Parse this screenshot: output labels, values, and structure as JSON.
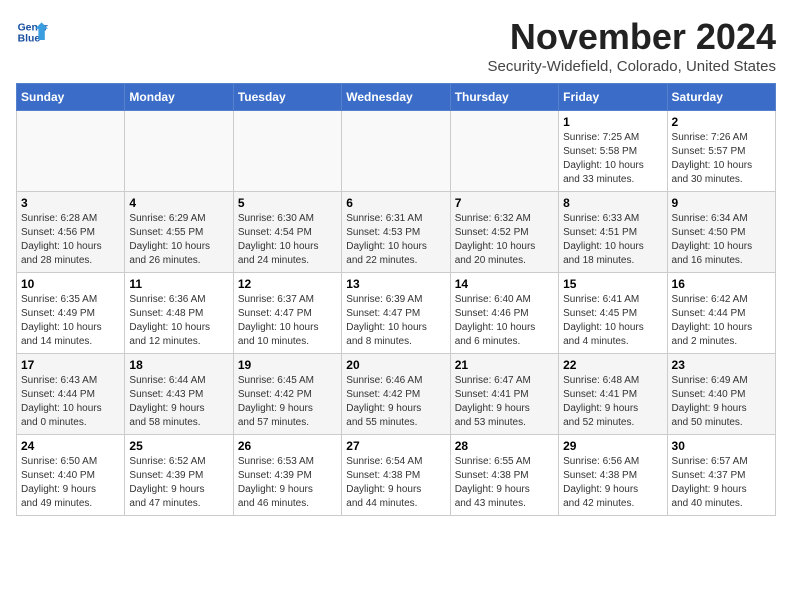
{
  "header": {
    "logo_line1": "General",
    "logo_line2": "Blue",
    "month_year": "November 2024",
    "location": "Security-Widefield, Colorado, United States"
  },
  "weekdays": [
    "Sunday",
    "Monday",
    "Tuesday",
    "Wednesday",
    "Thursday",
    "Friday",
    "Saturday"
  ],
  "weeks": [
    [
      {
        "day": "",
        "info": ""
      },
      {
        "day": "",
        "info": ""
      },
      {
        "day": "",
        "info": ""
      },
      {
        "day": "",
        "info": ""
      },
      {
        "day": "",
        "info": ""
      },
      {
        "day": "1",
        "info": "Sunrise: 7:25 AM\nSunset: 5:58 PM\nDaylight: 10 hours\nand 33 minutes."
      },
      {
        "day": "2",
        "info": "Sunrise: 7:26 AM\nSunset: 5:57 PM\nDaylight: 10 hours\nand 30 minutes."
      }
    ],
    [
      {
        "day": "3",
        "info": "Sunrise: 6:28 AM\nSunset: 4:56 PM\nDaylight: 10 hours\nand 28 minutes."
      },
      {
        "day": "4",
        "info": "Sunrise: 6:29 AM\nSunset: 4:55 PM\nDaylight: 10 hours\nand 26 minutes."
      },
      {
        "day": "5",
        "info": "Sunrise: 6:30 AM\nSunset: 4:54 PM\nDaylight: 10 hours\nand 24 minutes."
      },
      {
        "day": "6",
        "info": "Sunrise: 6:31 AM\nSunset: 4:53 PM\nDaylight: 10 hours\nand 22 minutes."
      },
      {
        "day": "7",
        "info": "Sunrise: 6:32 AM\nSunset: 4:52 PM\nDaylight: 10 hours\nand 20 minutes."
      },
      {
        "day": "8",
        "info": "Sunrise: 6:33 AM\nSunset: 4:51 PM\nDaylight: 10 hours\nand 18 minutes."
      },
      {
        "day": "9",
        "info": "Sunrise: 6:34 AM\nSunset: 4:50 PM\nDaylight: 10 hours\nand 16 minutes."
      }
    ],
    [
      {
        "day": "10",
        "info": "Sunrise: 6:35 AM\nSunset: 4:49 PM\nDaylight: 10 hours\nand 14 minutes."
      },
      {
        "day": "11",
        "info": "Sunrise: 6:36 AM\nSunset: 4:48 PM\nDaylight: 10 hours\nand 12 minutes."
      },
      {
        "day": "12",
        "info": "Sunrise: 6:37 AM\nSunset: 4:47 PM\nDaylight: 10 hours\nand 10 minutes."
      },
      {
        "day": "13",
        "info": "Sunrise: 6:39 AM\nSunset: 4:47 PM\nDaylight: 10 hours\nand 8 minutes."
      },
      {
        "day": "14",
        "info": "Sunrise: 6:40 AM\nSunset: 4:46 PM\nDaylight: 10 hours\nand 6 minutes."
      },
      {
        "day": "15",
        "info": "Sunrise: 6:41 AM\nSunset: 4:45 PM\nDaylight: 10 hours\nand 4 minutes."
      },
      {
        "day": "16",
        "info": "Sunrise: 6:42 AM\nSunset: 4:44 PM\nDaylight: 10 hours\nand 2 minutes."
      }
    ],
    [
      {
        "day": "17",
        "info": "Sunrise: 6:43 AM\nSunset: 4:44 PM\nDaylight: 10 hours\nand 0 minutes."
      },
      {
        "day": "18",
        "info": "Sunrise: 6:44 AM\nSunset: 4:43 PM\nDaylight: 9 hours\nand 58 minutes."
      },
      {
        "day": "19",
        "info": "Sunrise: 6:45 AM\nSunset: 4:42 PM\nDaylight: 9 hours\nand 57 minutes."
      },
      {
        "day": "20",
        "info": "Sunrise: 6:46 AM\nSunset: 4:42 PM\nDaylight: 9 hours\nand 55 minutes."
      },
      {
        "day": "21",
        "info": "Sunrise: 6:47 AM\nSunset: 4:41 PM\nDaylight: 9 hours\nand 53 minutes."
      },
      {
        "day": "22",
        "info": "Sunrise: 6:48 AM\nSunset: 4:41 PM\nDaylight: 9 hours\nand 52 minutes."
      },
      {
        "day": "23",
        "info": "Sunrise: 6:49 AM\nSunset: 4:40 PM\nDaylight: 9 hours\nand 50 minutes."
      }
    ],
    [
      {
        "day": "24",
        "info": "Sunrise: 6:50 AM\nSunset: 4:40 PM\nDaylight: 9 hours\nand 49 minutes."
      },
      {
        "day": "25",
        "info": "Sunrise: 6:52 AM\nSunset: 4:39 PM\nDaylight: 9 hours\nand 47 minutes."
      },
      {
        "day": "26",
        "info": "Sunrise: 6:53 AM\nSunset: 4:39 PM\nDaylight: 9 hours\nand 46 minutes."
      },
      {
        "day": "27",
        "info": "Sunrise: 6:54 AM\nSunset: 4:38 PM\nDaylight: 9 hours\nand 44 minutes."
      },
      {
        "day": "28",
        "info": "Sunrise: 6:55 AM\nSunset: 4:38 PM\nDaylight: 9 hours\nand 43 minutes."
      },
      {
        "day": "29",
        "info": "Sunrise: 6:56 AM\nSunset: 4:38 PM\nDaylight: 9 hours\nand 42 minutes."
      },
      {
        "day": "30",
        "info": "Sunrise: 6:57 AM\nSunset: 4:37 PM\nDaylight: 9 hours\nand 40 minutes."
      }
    ]
  ]
}
